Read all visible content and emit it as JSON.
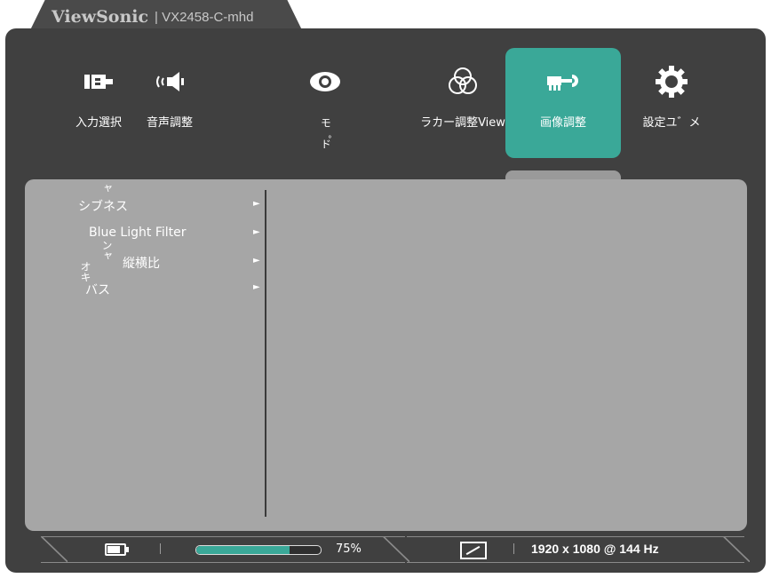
{
  "header": {
    "brand": "ViewSonic",
    "separator": "|",
    "model": "VX2458-C-mhd"
  },
  "tabs": [
    {
      "id": "input",
      "label": "入力選択",
      "icon": "input-source-icon",
      "active": false
    },
    {
      "id": "audio",
      "label": "音声調整",
      "icon": "speaker-icon",
      "active": false
    },
    {
      "id": "view",
      "label": "モ゜ド",
      "icon": "eye-icon",
      "active": false
    },
    {
      "id": "color",
      "label": "ラカー調整View",
      "icon": "color-circles-icon",
      "active": false
    },
    {
      "id": "image",
      "label": "画像調整",
      "icon": "image-adjust-icon",
      "active": true
    },
    {
      "id": "setup",
      "label": "設定ユ゛メ",
      "icon": "gear-icon",
      "active": false
    }
  ],
  "menu": {
    "items": [
      {
        "label": "シブネス",
        "prefix": "ャ",
        "arrow": "►"
      },
      {
        "label": "Blue Light Filter",
        "arrow": "►"
      },
      {
        "label": "縦横比",
        "prefix": "ンャ",
        "arrow": "►"
      },
      {
        "label": "バス",
        "prefix": "オキ",
        "arrow": "►"
      }
    ]
  },
  "status": {
    "battery_icon": "battery-icon",
    "progress_value": 0.75,
    "progress_text": "75%",
    "aspect_icon": "aspect-ratio-icon",
    "resolution": "1920 x 1080 @ 144 Hz"
  },
  "colors": {
    "accent": "#3aa898",
    "frame": "#404040",
    "panel": "#a6a6a6"
  }
}
